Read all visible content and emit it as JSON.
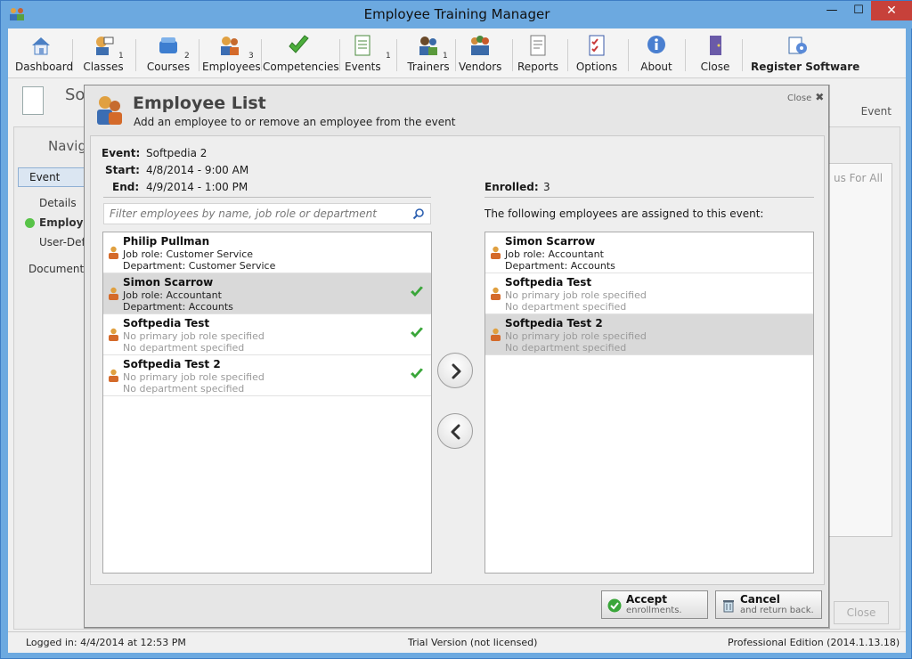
{
  "window": {
    "title": "Employee Training Manager",
    "minimize": "—",
    "maximize": "☐",
    "close": "✕"
  },
  "toolbar": {
    "items": [
      {
        "label": "Dashboard",
        "icon": "home-icon",
        "count": ""
      },
      {
        "label": "Classes",
        "icon": "classes-icon",
        "count": "1"
      },
      {
        "label": "Courses",
        "icon": "courses-icon",
        "count": "2"
      },
      {
        "label": "Employees",
        "icon": "employees-icon",
        "count": "3"
      },
      {
        "label": "Competencies",
        "icon": "checkmark-icon",
        "count": ""
      },
      {
        "label": "Events",
        "icon": "events-icon",
        "count": "1"
      },
      {
        "label": "Trainers",
        "icon": "trainers-icon",
        "count": "1"
      },
      {
        "label": "Vendors",
        "icon": "vendors-icon",
        "count": ""
      },
      {
        "label": "Reports",
        "icon": "reports-icon",
        "count": ""
      },
      {
        "label": "Options",
        "icon": "options-icon",
        "count": ""
      },
      {
        "label": "About",
        "icon": "info-icon",
        "count": ""
      },
      {
        "label": "Close",
        "icon": "door-icon",
        "count": ""
      },
      {
        "label": "Register Software",
        "icon": "register-icon",
        "count": ""
      }
    ]
  },
  "background": {
    "title": "Sof",
    "event_label": "Event",
    "nav_title": "Navig",
    "event_tab": "Event",
    "links": [
      "Details",
      "Employe",
      "User-Defi"
    ],
    "document_link": "Document",
    "status_for_all": "us For All",
    "close_button": "Close"
  },
  "dialog": {
    "title": "Employee List",
    "subtitle": "Add an employee to or remove an employee from the event",
    "close_label": "Close",
    "event_label": "Event:",
    "event_value": "Softpedia 2",
    "start_label": "Start:",
    "start_value": "4/8/2014 - 9:00 AM",
    "end_label": "End:",
    "end_value": "4/9/2014 - 1:00 PM",
    "enrolled_label": "Enrolled:",
    "enrolled_value": "3",
    "assigned_text": "The following employees are assigned to this event:",
    "search_placeholder": "Filter employees by name, job role or department",
    "available": [
      {
        "name": "Philip Pullman",
        "role": "Job role: Customer Service",
        "dept": "Department: Customer Service",
        "checked": false,
        "selected": false
      },
      {
        "name": "Simon Scarrow",
        "role": "Job role: Accountant",
        "dept": "Department: Accounts",
        "checked": true,
        "selected": true
      },
      {
        "name": "Softpedia Test",
        "role": "No primary job role specified",
        "dept": "No department specified",
        "checked": true,
        "selected": false
      },
      {
        "name": "Softpedia Test 2",
        "role": "No primary job role specified",
        "dept": "No department specified",
        "checked": true,
        "selected": false
      }
    ],
    "enrolled": [
      {
        "name": "Simon Scarrow",
        "role": "Job role: Accountant",
        "dept": "Department: Accounts",
        "selected": false
      },
      {
        "name": "Softpedia Test",
        "role": "No primary job role specified",
        "dept": "No department specified",
        "selected": false
      },
      {
        "name": "Softpedia Test 2",
        "role": "No primary job role specified",
        "dept": "No department specified",
        "selected": true
      }
    ],
    "accept_title": "Accept",
    "accept_sub": "enrollments.",
    "cancel_title": "Cancel",
    "cancel_sub": "and return back."
  },
  "statusbar": {
    "logged_in": "Logged in:  4/4/2014 at 12:53 PM",
    "license": "Trial Version (not licensed)",
    "edition": "Professional Edition (2014.1.13.18)"
  },
  "colors": {
    "check_green": "#3aa63a",
    "person_orange": "#d9662a",
    "titlebar_blue": "#6ca9e0"
  }
}
